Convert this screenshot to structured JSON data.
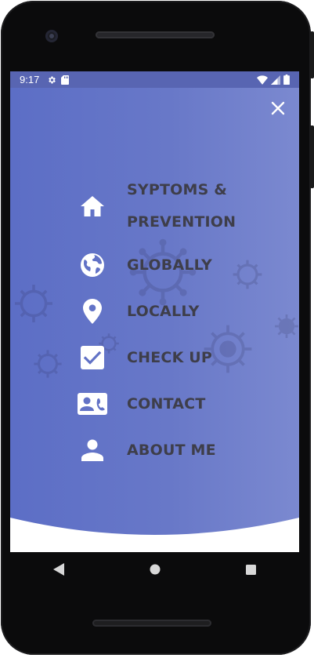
{
  "statusbar": {
    "time": "9:17",
    "icons_left": [
      "settings-icon",
      "sd-card-icon"
    ],
    "icons_right": [
      "wifi-icon",
      "cellular-signal-icon",
      "battery-icon"
    ]
  },
  "drawer": {
    "close_icon": "close-icon",
    "background_color": "#6272c6",
    "label_color": "#3e3e4a",
    "items": [
      {
        "icon": "home-icon",
        "label_line1": "SYPTOMS &",
        "label_line2": "PREVENTION"
      },
      {
        "icon": "globe-icon",
        "label": "GLOBALLY"
      },
      {
        "icon": "location-pin-icon",
        "label": "LOCALLY"
      },
      {
        "icon": "checkbox-icon",
        "label": "CHECK UP"
      },
      {
        "icon": "contact-card-icon",
        "label": "CONTACT"
      },
      {
        "icon": "person-icon",
        "label": "ABOUT ME"
      }
    ]
  },
  "navbar": {
    "buttons": [
      "back-icon",
      "home-circle-icon",
      "recents-square-icon"
    ]
  }
}
